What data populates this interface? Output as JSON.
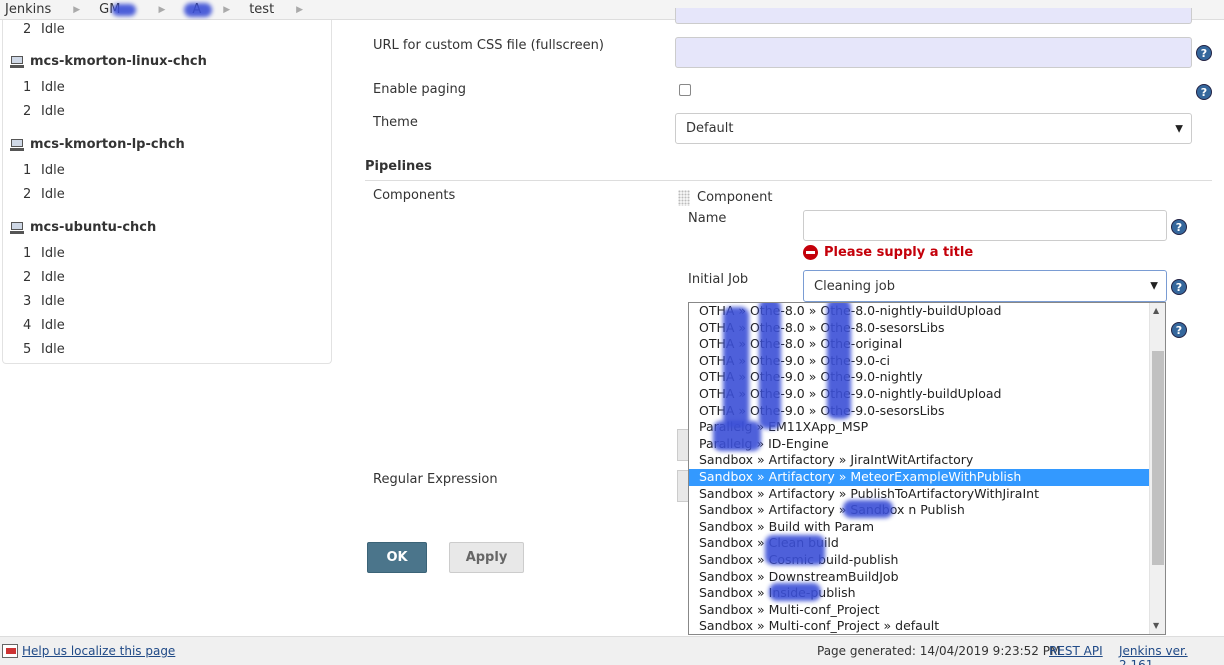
{
  "breadcrumb": [
    {
      "label": "Jenkins"
    },
    {
      "label": "GM"
    },
    {
      "label": "A"
    },
    {
      "label": "test"
    }
  ],
  "executors": {
    "pre_rows": [
      {
        "num": "2",
        "status": "Idle"
      }
    ],
    "computers": [
      {
        "name": "mcs-kmorton-linux-chch",
        "rows": [
          {
            "num": "1",
            "status": "Idle"
          },
          {
            "num": "2",
            "status": "Idle"
          }
        ]
      },
      {
        "name": "mcs-kmorton-lp-chch",
        "rows": [
          {
            "num": "1",
            "status": "Idle"
          },
          {
            "num": "2",
            "status": "Idle"
          }
        ]
      },
      {
        "name": "mcs-ubuntu-chch",
        "rows": [
          {
            "num": "1",
            "status": "Idle"
          },
          {
            "num": "2",
            "status": "Idle"
          },
          {
            "num": "3",
            "status": "Idle"
          },
          {
            "num": "4",
            "status": "Idle"
          },
          {
            "num": "5",
            "status": "Idle"
          }
        ]
      }
    ]
  },
  "form": {
    "css_url_label": "URL for custom CSS file (fullscreen)",
    "css_url_value": "",
    "enable_paging_label": "Enable paging",
    "enable_paging_checked": false,
    "theme_label": "Theme",
    "theme_value": "Default",
    "pipelines_title": "Pipelines",
    "components_label": "Components",
    "component_heading": "Component",
    "name_label": "Name",
    "name_value": "",
    "name_error": "Please supply a title",
    "initial_job_label": "Initial Job",
    "initial_job_value": "Cleaning job",
    "regex_label": "Regular Expression",
    "ok_label": "OK",
    "apply_label": "Apply",
    "help_glyph": "?"
  },
  "dropdown": {
    "options": [
      "OTHA » Othe-8.0 » Othe-8.0-nightly-buildUpload",
      "OTHA » Othe-8.0 » Othe-8.0-sesorsLibs",
      "OTHA » Othe-8.0 » Othe-original",
      "OTHA » Othe-9.0 » Othe-9.0-ci",
      "OTHA » Othe-9.0 » Othe-9.0-nightly",
      "OTHA » Othe-9.0 » Othe-9.0-nightly-buildUpload",
      "OTHA » Othe-9.0 » Othe-9.0-sesorsLibs",
      "Parallelg » EM11XApp_MSP",
      "Parallelg » ID-Engine",
      "Sandbox » Artifactory » JiraIntWitArtifactory",
      "Sandbox » Artifactory » MeteorExampleWithPublish",
      "Sandbox » Artifactory » PublishToArtifactoryWithJiraInt",
      "Sandbox » Artifactory » Sandbox n Publish",
      "Sandbox » Build with Param",
      "Sandbox » Clean build",
      "Sandbox » Cosmic build-publish",
      "Sandbox » DownstreamBuildJob",
      "Sandbox » Inside-publish",
      "Sandbox » Multi-conf_Project",
      "Sandbox » Multi-conf_Project » default"
    ],
    "selected_index": 10
  },
  "footer": {
    "localize_link": "Help us localize this page",
    "generated": "Page generated: 14/04/2019 9:23:52 PM",
    "rest_api": "REST API",
    "version": "Jenkins ver. 2.161"
  },
  "colors": {
    "selection": "#3399ff",
    "ok_button": "#4b758b",
    "error": "#c4000a",
    "help_icon": "#35679c",
    "redaction": "#3b4fd6"
  },
  "icons": [
    "computer-icon",
    "help-icon",
    "error-icon",
    "grip-icon",
    "chevron-right-icon",
    "dropdown-arrow-icon",
    "localize-icon"
  ]
}
